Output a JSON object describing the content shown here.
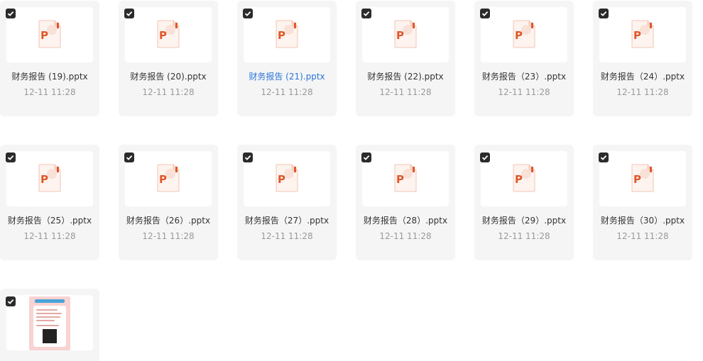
{
  "files": [
    {
      "name": "财务报告 (19).pptx",
      "date": "12-11 11:28",
      "type": "pptx",
      "checked": true,
      "highlighted": false
    },
    {
      "name": "财务报告 (20).pptx",
      "date": "12-11 11:28",
      "type": "pptx",
      "checked": true,
      "highlighted": false
    },
    {
      "name": "财务报告 (21).pptx",
      "date": "12-11 11:28",
      "type": "pptx",
      "checked": true,
      "highlighted": true
    },
    {
      "name": "财务报告 (22).pptx",
      "date": "12-11 11:28",
      "type": "pptx",
      "checked": true,
      "highlighted": false
    },
    {
      "name": "财务报告（23）.pptx",
      "date": "12-11 11:28",
      "type": "pptx",
      "checked": true,
      "highlighted": false
    },
    {
      "name": "财务报告（24）.pptx",
      "date": "12-11 11:28",
      "type": "pptx",
      "checked": true,
      "highlighted": false
    },
    {
      "name": "财务报告（25）.pptx",
      "date": "12-11 11:28",
      "type": "pptx",
      "checked": true,
      "highlighted": false
    },
    {
      "name": "财务报告（26）.pptx",
      "date": "12-11 11:28",
      "type": "pptx",
      "checked": true,
      "highlighted": false
    },
    {
      "name": "财务报告（27）.pptx",
      "date": "12-11 11:28",
      "type": "pptx",
      "checked": true,
      "highlighted": false
    },
    {
      "name": "财务报告（28）.pptx",
      "date": "12-11 11:28",
      "type": "pptx",
      "checked": true,
      "highlighted": false
    },
    {
      "name": "财务报告（29）.pptx",
      "date": "12-11 11:28",
      "type": "pptx",
      "checked": true,
      "highlighted": false
    },
    {
      "name": "财务报告（30）.pptx",
      "date": "12-11 11:28",
      "type": "pptx",
      "checked": true,
      "highlighted": false
    },
    {
      "name": "",
      "date": "",
      "type": "image",
      "checked": true,
      "highlighted": false
    }
  ],
  "colors": {
    "ppt_accent": "#e0582b",
    "ppt_light": "#f7d7cb",
    "highlight_text": "#2b74d6",
    "card_bg": "#f5f5f6",
    "checkbox_bg": "#2b2b2b"
  },
  "icons": {
    "checkbox": "checkmark-icon",
    "pptx": "powerpoint-file-icon",
    "image": "image-thumbnail"
  }
}
